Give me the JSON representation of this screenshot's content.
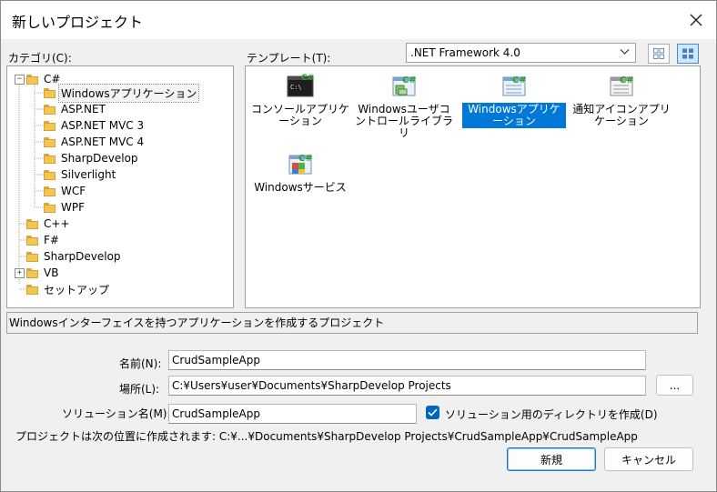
{
  "window": {
    "title": "新しいプロジェクト"
  },
  "categories": {
    "label": "カテゴリ(C):",
    "items": [
      {
        "label": "C#",
        "expander": "−"
      },
      {
        "label": "Windowsアプリケーション"
      },
      {
        "label": "ASP.NET"
      },
      {
        "label": "ASP.NET MVC 3"
      },
      {
        "label": "ASP.NET MVC 4"
      },
      {
        "label": "SharpDevelop"
      },
      {
        "label": "Silverlight"
      },
      {
        "label": "WCF"
      },
      {
        "label": "WPF"
      },
      {
        "label": "C++"
      },
      {
        "label": "F#"
      },
      {
        "label": "SharpDevelop"
      },
      {
        "label": "VB",
        "expander": "+"
      },
      {
        "label": "セットアップ"
      }
    ]
  },
  "templates": {
    "label": "テンプレート(T):",
    "framework": ".NET Framework 4.0",
    "items": [
      {
        "label": "コンソールアプリケーション",
        "icon_text": "C:\\"
      },
      {
        "label": "Windowsユーザコントロールライブラリ",
        "icon_text": "C#"
      },
      {
        "label": "Windowsアプリケーション",
        "icon_text": "C#"
      },
      {
        "label": "通知アイコンアプリケーション",
        "icon_text": "C#"
      },
      {
        "label": "Windowsサービス",
        "icon_text": "C#"
      }
    ]
  },
  "description": "Windowsインターフェイスを持つアプリケーションを作成するプロジェクト",
  "form": {
    "name_label": "名前(N):",
    "name_value": "CrudSampleApp",
    "location_label": "場所(L):",
    "location_value": "C:¥Users¥user¥Documents¥SharpDevelop Projects",
    "browse_label": "...",
    "solution_label": "ソリューション名(M):",
    "solution_value": "CrudSampleApp",
    "create_dir_label": "ソリューション用のディレクトリを作成(D)",
    "path_info": "プロジェクトは次の位置に作成されます: C:¥...¥Documents¥SharpDevelop Projects¥CrudSampleApp¥CrudSampleApp"
  },
  "buttons": {
    "ok": "新規",
    "cancel": "キャンセル"
  },
  "colors": {
    "selection": "#0078d7",
    "csharp_green": "#26a326",
    "folder": "#f2c650"
  }
}
